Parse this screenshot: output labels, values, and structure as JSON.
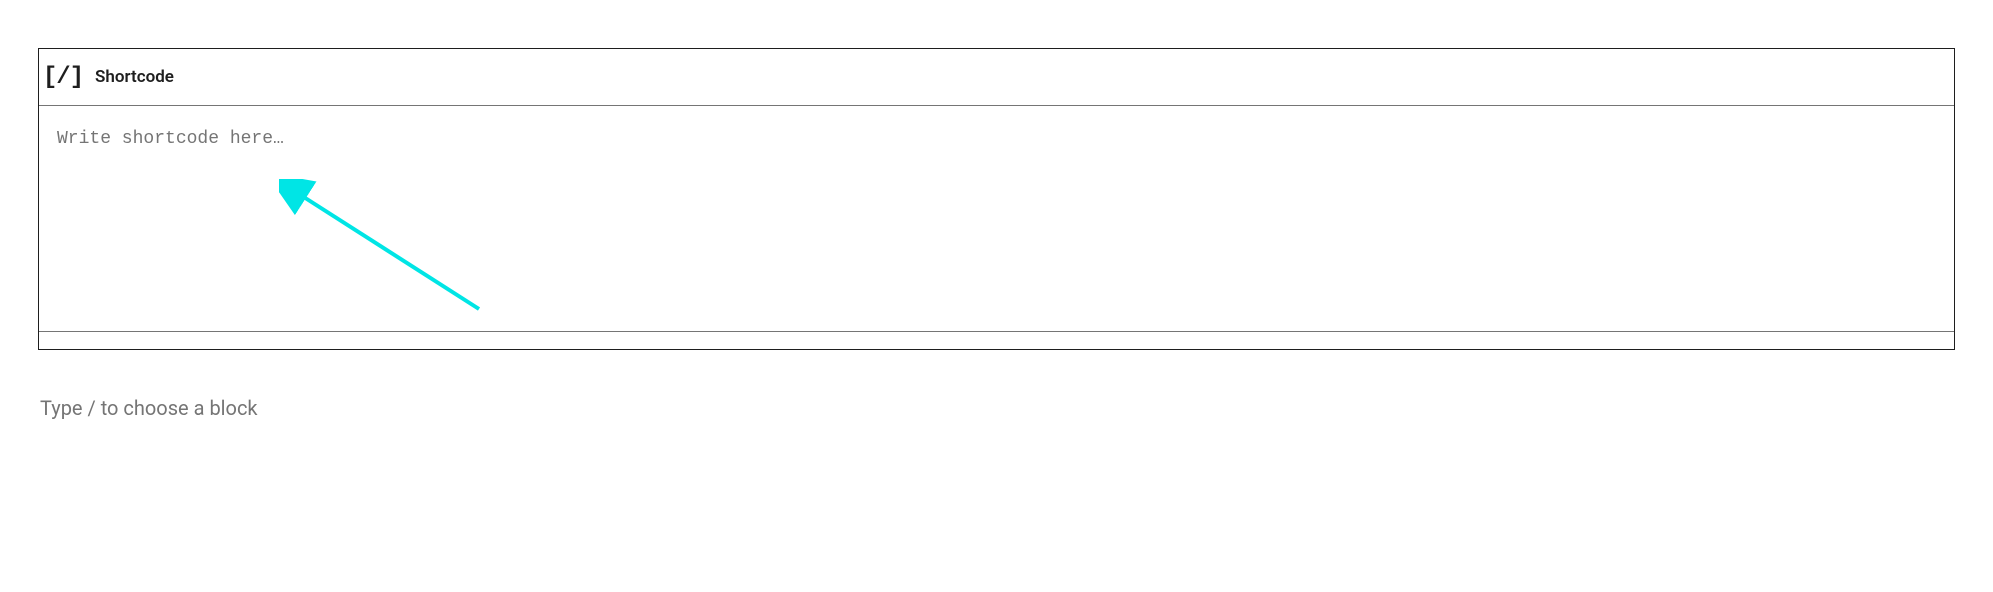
{
  "block": {
    "icon_glyph": "[/]",
    "title": "Shortcode",
    "input_placeholder": "Write shortcode here…",
    "input_value": ""
  },
  "prompt_text": "Type / to choose a block",
  "annotation": {
    "arrow_color": "#00e5e5"
  }
}
